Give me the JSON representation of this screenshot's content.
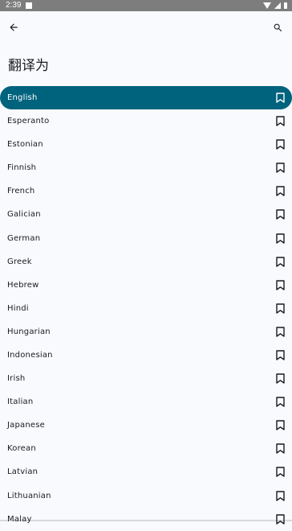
{
  "status": {
    "time": "2:39"
  },
  "toolbar": {
    "back_icon": "arrow-left-icon",
    "search_icon": "search-icon"
  },
  "page": {
    "title": "翻译为"
  },
  "languages": [
    {
      "label": "English",
      "selected": true
    },
    {
      "label": "Esperanto",
      "selected": false
    },
    {
      "label": "Estonian",
      "selected": false
    },
    {
      "label": "Finnish",
      "selected": false
    },
    {
      "label": "French",
      "selected": false
    },
    {
      "label": "Galician",
      "selected": false
    },
    {
      "label": "German",
      "selected": false
    },
    {
      "label": "Greek",
      "selected": false
    },
    {
      "label": "Hebrew",
      "selected": false
    },
    {
      "label": "Hindi",
      "selected": false
    },
    {
      "label": "Hungarian",
      "selected": false
    },
    {
      "label": "Indonesian",
      "selected": false
    },
    {
      "label": "Irish",
      "selected": false
    },
    {
      "label": "Italian",
      "selected": false
    },
    {
      "label": "Japanese",
      "selected": false
    },
    {
      "label": "Korean",
      "selected": false
    },
    {
      "label": "Latvian",
      "selected": false
    },
    {
      "label": "Lithuanian",
      "selected": false
    },
    {
      "label": "Malay",
      "selected": false
    }
  ],
  "colors": {
    "accent": "#00637d",
    "background": "#f8fafd",
    "text": "#1b1b1f"
  }
}
